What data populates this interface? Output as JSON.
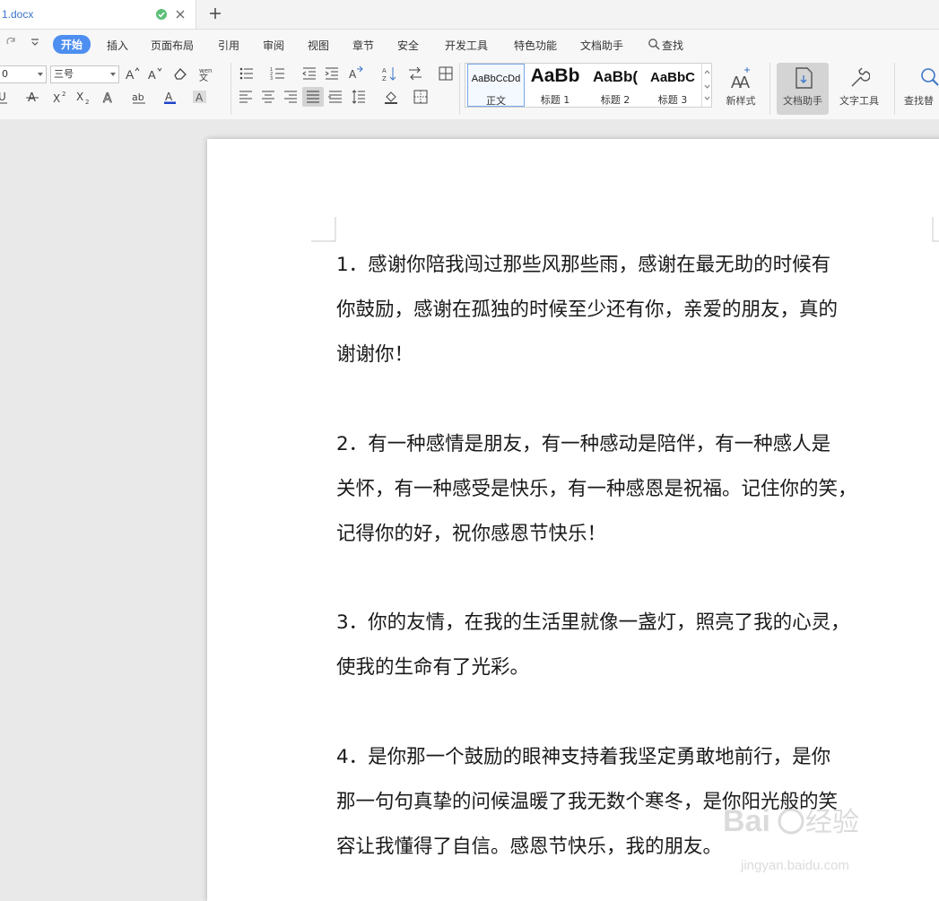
{
  "tab": {
    "filename": "1.docx"
  },
  "menu": {
    "items": [
      "开始",
      "插入",
      "页面布局",
      "引用",
      "审阅",
      "视图",
      "章节",
      "安全",
      "开发工具",
      "特色功能",
      "文档助手",
      "查找"
    ]
  },
  "ribbon": {
    "font_name": "0",
    "font_size": "三号",
    "styles": [
      {
        "preview": "AaBbCcDd",
        "label": "正文"
      },
      {
        "preview": "AaBb",
        "label": "标题 1"
      },
      {
        "preview": "AaBb(",
        "label": "标题 2"
      },
      {
        "preview": "AaBbC",
        "label": "标题 3"
      }
    ],
    "new_style": "新样式",
    "doc_assistant": "文档助手",
    "text_tools": "文字工具",
    "find_replace": "查找替"
  },
  "document": {
    "paragraphs": [
      {
        "lines": [
          "1．感谢你陪我闯过那些风那些雨，感谢在最无助的时候有",
          "你鼓励，感谢在孤独的时候至少还有你，亲爱的朋友，真的",
          "谢谢你！"
        ]
      },
      {
        "lines": [
          "2．有一种感情是朋友，有一种感动是陪伴，有一种感人是",
          "关怀，有一种感受是快乐，有一种感恩是祝福。记住你的笑，",
          "记得你的好，祝你感恩节快乐！"
        ]
      },
      {
        "lines": [
          "3．你的友情，在我的生活里就像一盏灯，照亮了我的心灵，",
          "使我的生命有了光彩。"
        ]
      },
      {
        "lines": [
          "4．是你那一个鼓励的眼神支持着我坚定勇敢地前行，是你",
          "那一句句真挚的问候温暖了我无数个寒冬，是你阳光般的笑",
          "容让我懂得了自信。感恩节快乐，我的朋友。"
        ]
      }
    ]
  },
  "watermark": {
    "brand": "Baidu经验",
    "url": "jingyan.baidu.com"
  },
  "colors": {
    "accent": "#4d8ef0",
    "saved": "#3cb371",
    "font_color_bar": "#1c44c8"
  }
}
